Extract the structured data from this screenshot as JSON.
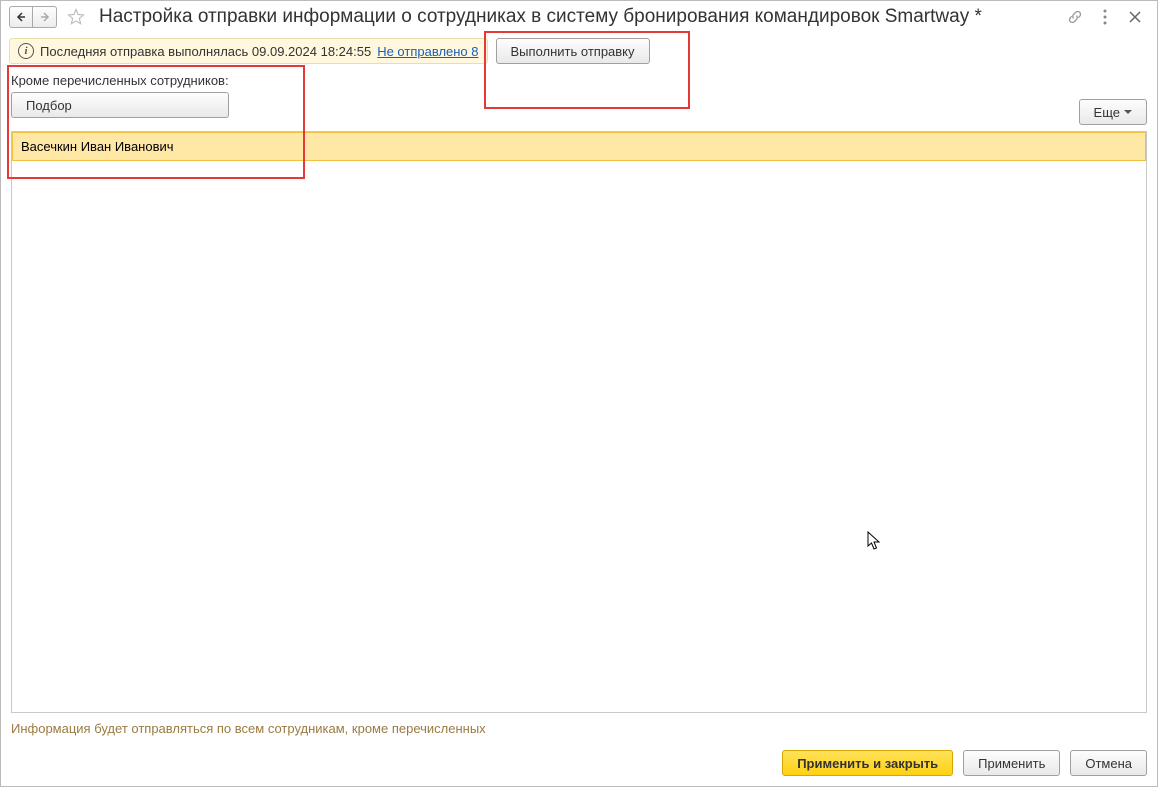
{
  "title": "Настройка отправки информации о сотрудниках в систему бронирования командировок Smartway *",
  "nav": {
    "back_tooltip": "Назад",
    "forward_tooltip": "Вперёд"
  },
  "info_bar": {
    "status_text": "Последняя отправка выполнялась 09.09.2024 18:24:55",
    "link_text": "Не отправлено 8",
    "send_button": "Выполнить отправку"
  },
  "section": {
    "label": "Кроме перечисленных сотрудников:",
    "select_button": "Подбор",
    "more_button": "Еще"
  },
  "employees": [
    {
      "name": "Васечкин Иван Иванович"
    }
  ],
  "footer": {
    "note": "Информация будет отправляться по всем сотрудникам, кроме перечисленных",
    "apply_close": "Применить и закрыть",
    "apply": "Применить",
    "cancel": "Отмена"
  }
}
